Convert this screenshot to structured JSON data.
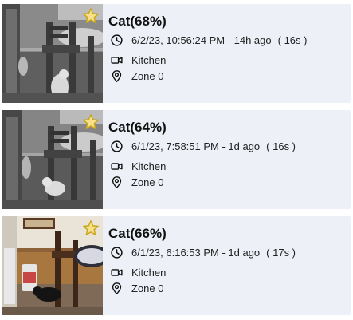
{
  "events": [
    {
      "title": "Cat(68%)",
      "time": "6/2/23, 10:56:24 PM - 14h ago",
      "duration": "( 16s )",
      "camera": "Kitchen",
      "zone": "Zone 0",
      "favorite": true,
      "icons": {
        "favorite": "star-icon",
        "time": "clock-icon",
        "camera": "video-camera-icon",
        "zone": "location-pin-icon"
      }
    },
    {
      "title": "Cat(64%)",
      "time": "6/1/23, 7:58:51 PM - 1d ago",
      "duration": "( 16s )",
      "camera": "Kitchen",
      "zone": "Zone 0",
      "favorite": true,
      "icons": {
        "favorite": "star-icon",
        "time": "clock-icon",
        "camera": "video-camera-icon",
        "zone": "location-pin-icon"
      }
    },
    {
      "title": "Cat(66%)",
      "time": "6/1/23, 6:16:53 PM - 1d ago",
      "duration": "( 17s )",
      "camera": "Kitchen",
      "zone": "Zone 0",
      "favorite": true,
      "icons": {
        "favorite": "star-icon",
        "time": "clock-icon",
        "camera": "video-camera-icon",
        "zone": "location-pin-icon"
      }
    }
  ],
  "colors": {
    "card_background": "#edf1f7",
    "star_fill": "#f7e08a",
    "star_stroke": "#c9a61c",
    "text": "#111111"
  }
}
